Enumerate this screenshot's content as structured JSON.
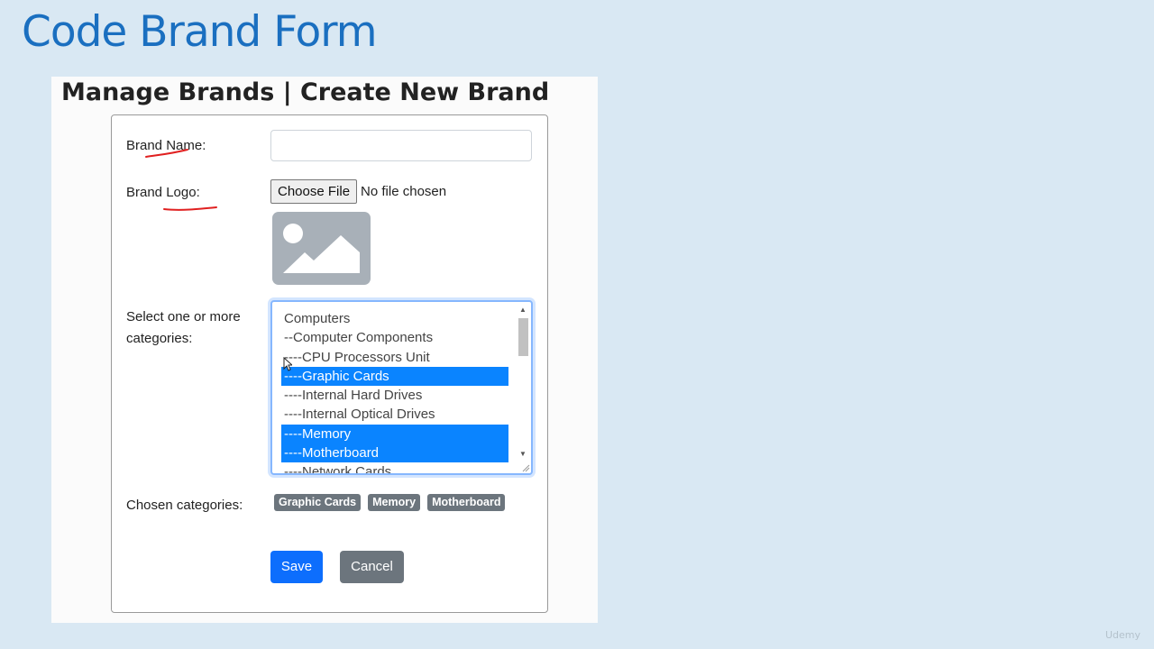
{
  "slide": {
    "title": "Code Brand Form"
  },
  "page": {
    "heading": "Manage Brands | Create New Brand"
  },
  "form": {
    "brand_name_label": "Brand Name:",
    "brand_name_value": "",
    "brand_logo_label": "Brand Logo:",
    "choose_file_label": "Choose File",
    "no_file_text": "No file chosen",
    "categories_label": "Select one or more categories:",
    "categories": [
      {
        "label": "Computers",
        "selected": false
      },
      {
        "label": "--Computer Components",
        "selected": false
      },
      {
        "label": "----CPU Processors Unit",
        "selected": false
      },
      {
        "label": "----Graphic Cards",
        "selected": true
      },
      {
        "label": "----Internal Hard Drives",
        "selected": false
      },
      {
        "label": "----Internal Optical Drives",
        "selected": false
      },
      {
        "label": "----Memory",
        "selected": true
      },
      {
        "label": "----Motherboard",
        "selected": true
      },
      {
        "label": "----Network Cards",
        "selected": false
      }
    ],
    "chosen_label": "Chosen categories:",
    "chosen": [
      "Graphic Cards",
      "Memory",
      "Motherboard"
    ],
    "save_label": "Save",
    "cancel_label": "Cancel"
  },
  "icons": {
    "logo_placeholder": "image-placeholder-icon",
    "cursor": "mouse-cursor-icon"
  },
  "colors": {
    "title": "#1a6fc0",
    "selected_option": "#0a84ff",
    "save_button": "#0d6efd",
    "cancel_button": "#6c757d",
    "badge": "#6c757d",
    "annotation_ink": "#e02020"
  },
  "watermark": "Udemy"
}
